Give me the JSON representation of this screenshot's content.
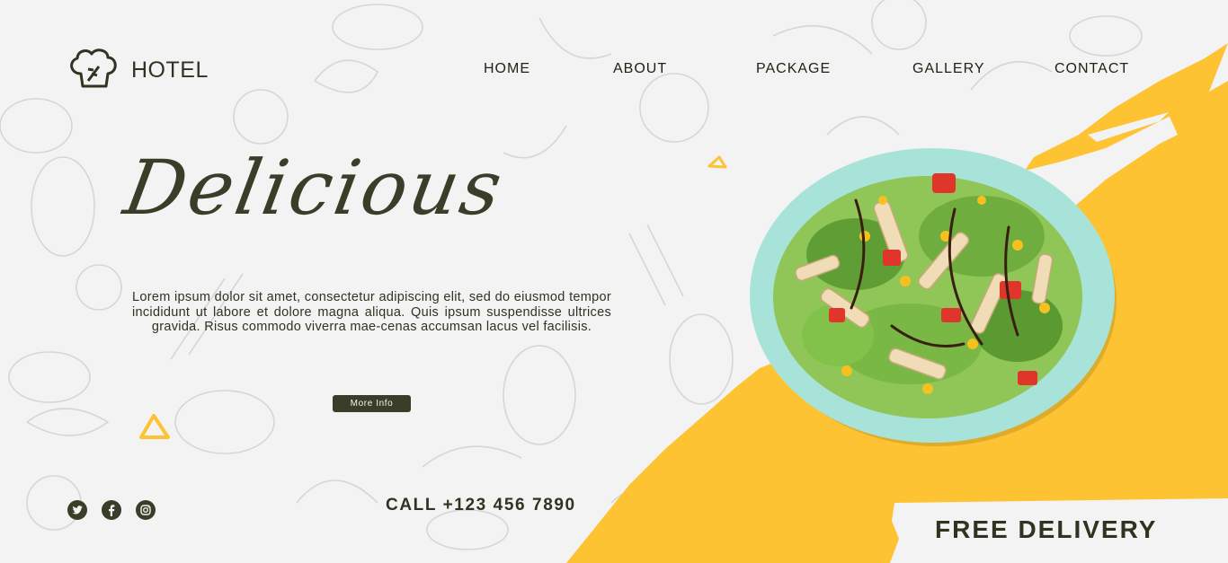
{
  "brand": {
    "name": "HOTEL",
    "logo_icon": "chef-hat-icon"
  },
  "nav": {
    "items": [
      "HOME",
      "ABOUT",
      "PACKAGE",
      "GALLERY",
      "CONTACT"
    ]
  },
  "hero": {
    "headline": "Delicious",
    "body": "Lorem ipsum dolor sit amet, consectetur adipiscing elit, sed do eiusmod tempor incididunt ut labore et dolore magna aliqua. Quis ipsum suspendisse ultrices gravida. Risus commodo viverra mae-cenas accumsan lacus vel facilisis.",
    "button_label": "More Info"
  },
  "contact": {
    "call": "CALL +123 456 7890"
  },
  "promo": {
    "delivery": "FREE DELIVERY"
  },
  "social": {
    "icons": [
      "twitter-icon",
      "facebook-icon",
      "instagram-icon"
    ]
  },
  "colors": {
    "accent": "#fdc332",
    "dark": "#3a3d28",
    "background": "#f3f3f3",
    "plate": "#a8e3d9"
  }
}
